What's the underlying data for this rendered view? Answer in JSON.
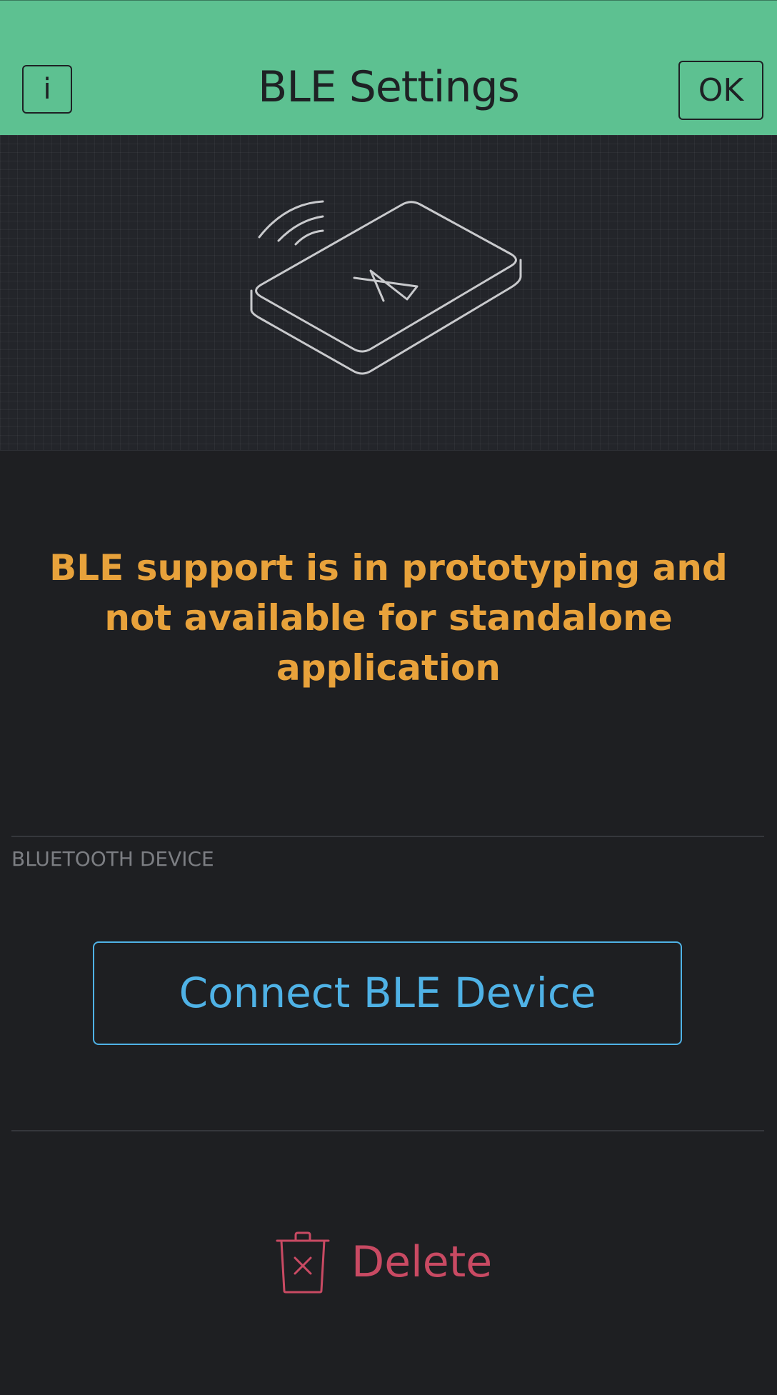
{
  "header": {
    "title": "BLE Settings",
    "info_label": "i",
    "ok_label": "OK"
  },
  "hero": {
    "icon": "ble-device-illustration"
  },
  "warning": {
    "text": "BLE support is in prototyping and not available for standalone application"
  },
  "section": {
    "label": "BLUETOOTH DEVICE"
  },
  "connect": {
    "label": "Connect BLE Device"
  },
  "delete": {
    "label": "Delete",
    "icon": "trash-icon"
  },
  "colors": {
    "header_bg": "#5dc191",
    "page_bg": "#1e1f22",
    "warning": "#e8a23b",
    "accent_blue": "#4fb2e6",
    "danger": "#c94a63"
  }
}
